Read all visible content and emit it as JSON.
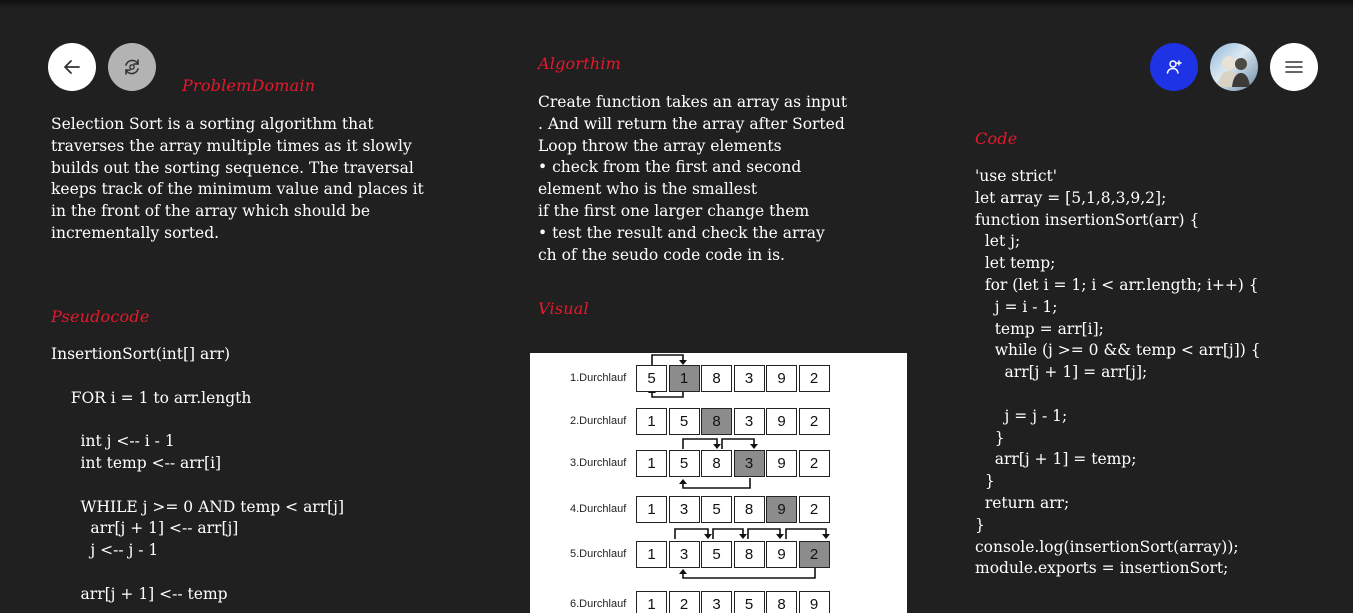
{
  "toolbar": {
    "back_icon": "arrow-left-icon",
    "refresh_icon": "refresh-icon",
    "user_icon": "person-add-icon",
    "menu_icon": "hamburger-menu-icon"
  },
  "problem": {
    "heading": "ProblemDomain",
    "text": "Selection Sort is a sorting algorithm that\ntraverses the array multiple times as it slowly\nbuilds out the sorting sequence. The traversal\nkeeps track of the minimum value and places it\nin the front of the array which should be\nincrementally sorted."
  },
  "pseudocode": {
    "heading": "Pseudocode",
    "text": "InsertionSort(int[] arr)\n\n    FOR i = 1 to arr.length\n\n      int j <-- i - 1\n      int temp <-- arr[i]\n\n      WHILE j >= 0 AND temp < arr[j]\n        arr[j + 1] <-- arr[j]\n        j <-- j - 1\n\n      arr[j + 1] <-- temp"
  },
  "algorithm": {
    "heading": "Algorthim",
    "text": "Create function takes an array as input\n. And will return the array after Sorted\nLoop throw the array elements\n• check from the first and second\nelement who is the smallest\nif the first one larger change them\n• test the result and check the array\nch of the seudo code code in is."
  },
  "visual": {
    "heading": "Visual",
    "passes": [
      {
        "label": "1.Durchlauf",
        "values": [
          "5",
          "1",
          "8",
          "3",
          "9",
          "2"
        ],
        "highlight": 1
      },
      {
        "label": "2.Durchlauf",
        "values": [
          "1",
          "5",
          "8",
          "3",
          "9",
          "2"
        ],
        "highlight": 2
      },
      {
        "label": "3.Durchlauf",
        "values": [
          "1",
          "5",
          "8",
          "3",
          "9",
          "2"
        ],
        "highlight": 3
      },
      {
        "label": "4.Durchlauf",
        "values": [
          "1",
          "3",
          "5",
          "8",
          "9",
          "2"
        ],
        "highlight": 4
      },
      {
        "label": "5.Durchlauf",
        "values": [
          "1",
          "3",
          "5",
          "8",
          "9",
          "2"
        ],
        "highlight": 5
      },
      {
        "label": "6.Durchlauf",
        "values": [
          "1",
          "2",
          "3",
          "5",
          "8",
          "9"
        ],
        "highlight": -1
      }
    ]
  },
  "code": {
    "heading": "Code",
    "text": "'use strict'\nlet array = [5,1,8,3,9,2];\nfunction insertionSort(arr) {\n  let j;\n  let temp;\n  for (let i = 1; i < arr.length; i++) {\n    j = i - 1;\n    temp = arr[i];\n    while (j >= 0 && temp < arr[j]) {\n      arr[j + 1] = arr[j];\n\n      j = j - 1;\n    }\n    arr[j + 1] = temp;\n  }\n  return arr;\n}\nconsole.log(insertionSort(array));\nmodule.exports = insertionSort;"
  }
}
